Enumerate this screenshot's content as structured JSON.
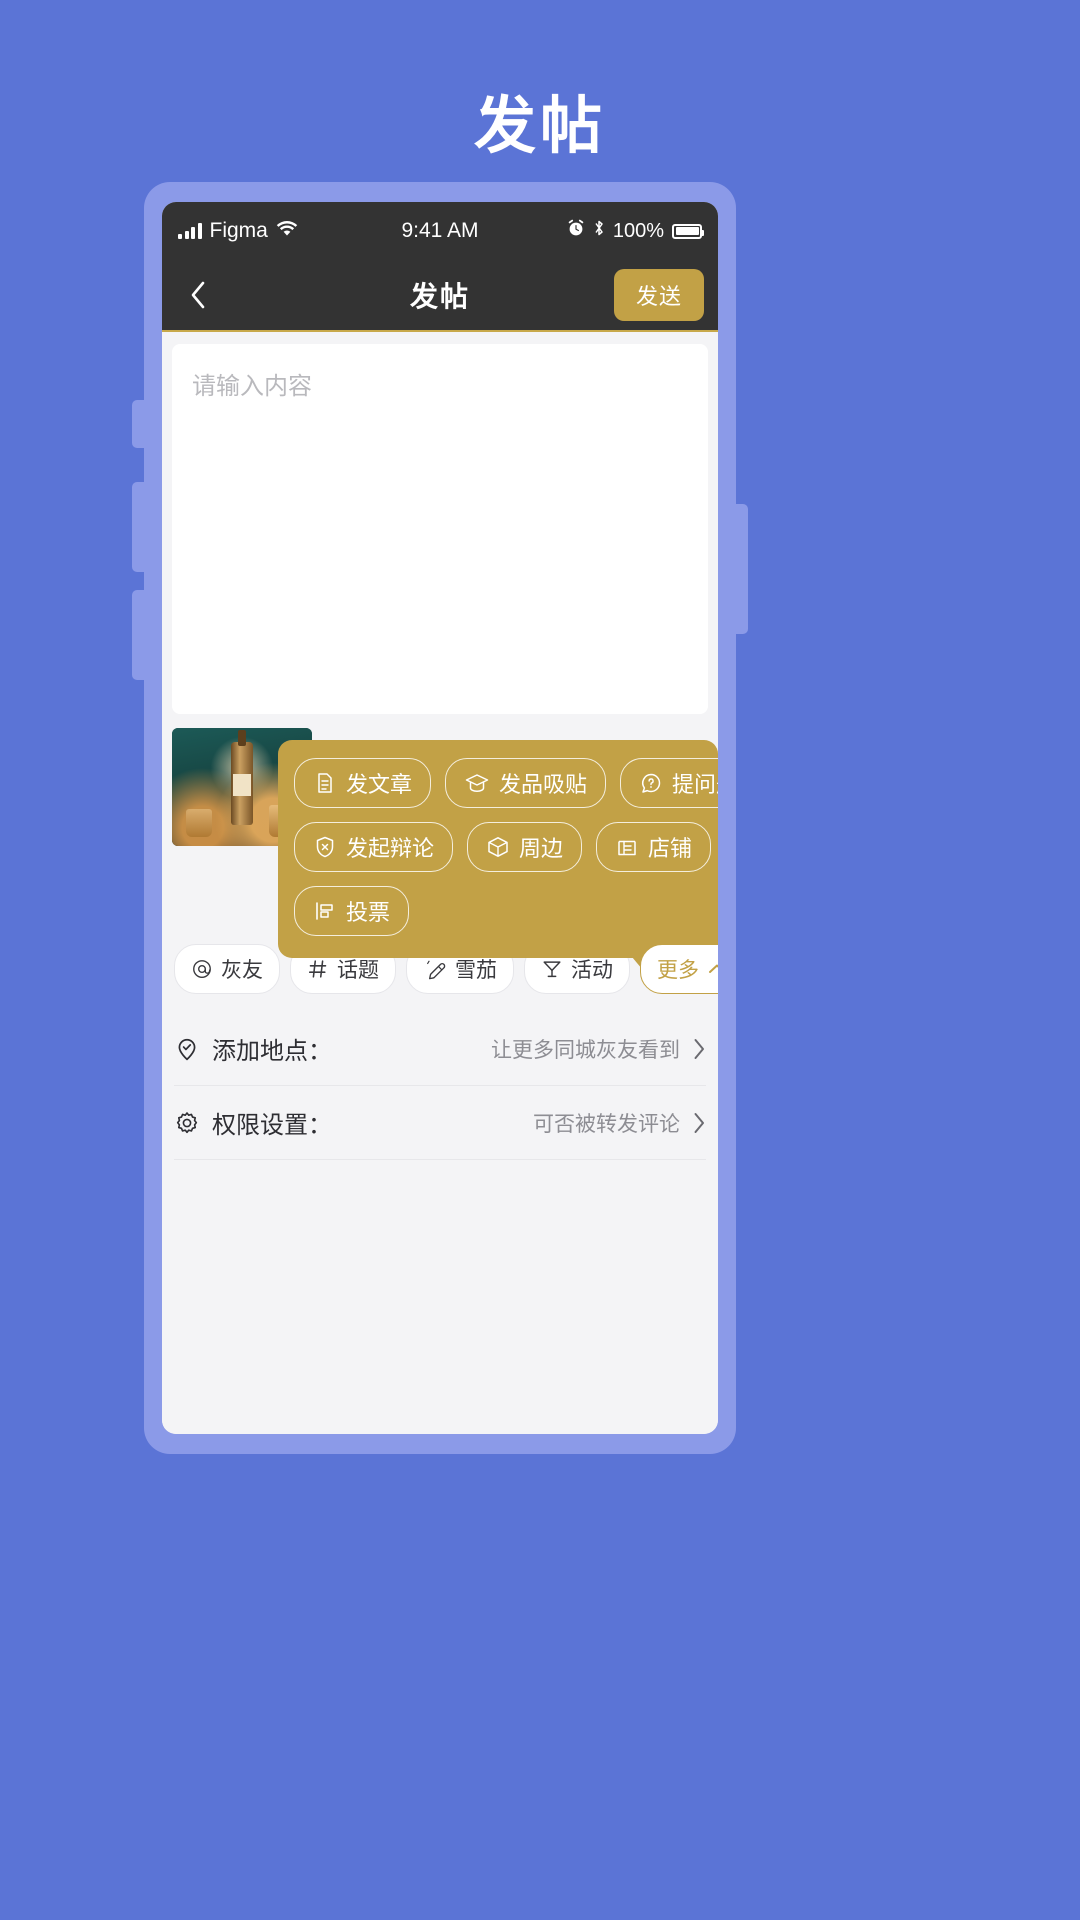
{
  "page": {
    "title": "发帖"
  },
  "status_bar": {
    "carrier": "Figma",
    "time": "9:41 AM",
    "battery_percent": "100%",
    "icons": [
      "signal-bars-icon",
      "wifi-icon",
      "alarm-icon",
      "bluetooth-icon",
      "battery-icon"
    ]
  },
  "nav": {
    "back_icon": "chevron-left-icon",
    "title": "发帖",
    "send_label": "发送"
  },
  "compose": {
    "placeholder": "请输入内容"
  },
  "media": {
    "thumbnail_alt": "whisky-bottle-photo"
  },
  "more_popup": {
    "visible": true,
    "background_color": "#c2a146",
    "items": [
      {
        "icon": "document-icon",
        "label": "发文章"
      },
      {
        "icon": "graduation-icon",
        "label": "发品吸贴"
      },
      {
        "icon": "question-icon",
        "label": "提问题"
      },
      {
        "icon": "shield-x-icon",
        "label": "发起辩论"
      },
      {
        "icon": "cube-icon",
        "label": "周边"
      },
      {
        "icon": "shop-icon",
        "label": "店铺"
      },
      {
        "icon": "poll-icon",
        "label": "投票"
      }
    ]
  },
  "tools": [
    {
      "icon": "at-icon",
      "label": "灰友"
    },
    {
      "icon": "hash-icon",
      "label": "话题"
    },
    {
      "icon": "cigar-icon",
      "label": "雪茄"
    },
    {
      "icon": "cocktail-icon",
      "label": "活动"
    }
  ],
  "more_chip": {
    "label": "更多",
    "icon": "chevron-up-icon"
  },
  "settings": [
    {
      "icon": "location-pin-icon",
      "label": "添加地点：",
      "value": "让更多同城灰友看到",
      "chevron": "chevron-right-icon"
    },
    {
      "icon": "gear-icon",
      "label": "权限设置：",
      "value": "可否被转发评论",
      "chevron": "chevron-right-icon"
    }
  ],
  "colors": {
    "page_background": "#5b74d6",
    "phone_frame": "#8b9ae8",
    "nav_background": "#333333",
    "accent_gold": "#c2a146",
    "screen_background": "#f4f4f6"
  }
}
